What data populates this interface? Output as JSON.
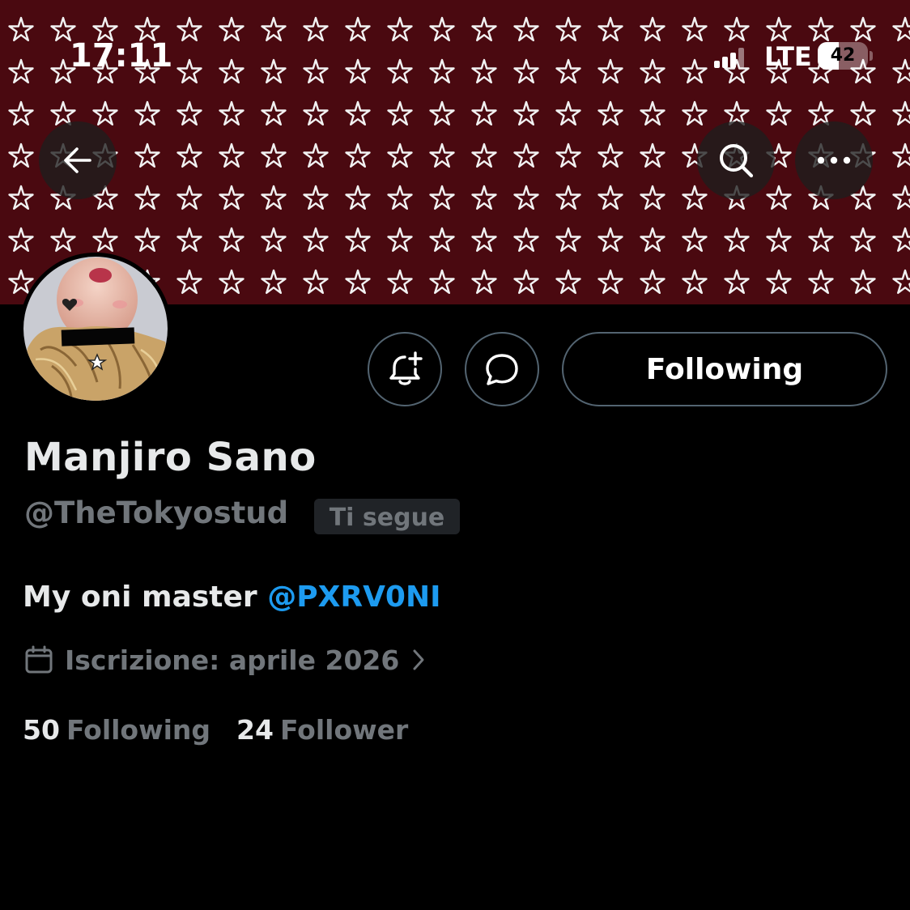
{
  "status_bar": {
    "time": "17:11",
    "network": "LTE",
    "battery_level": "42",
    "battery_fraction": 0.42
  },
  "header": {
    "back_icon": "arrow-left-icon",
    "search_icon": "search-icon",
    "more_icon": "more-horizontal-icon"
  },
  "banner": {
    "pattern": "white stars on dark red",
    "background_color": "#4a0910",
    "star_color": "#f2f2f2"
  },
  "actions": {
    "notifications_icon": "bell-plus-icon",
    "message_icon": "chat-bubble-icon",
    "following_label": "Following"
  },
  "profile": {
    "display_name": "Manjiro Sano",
    "handle": "@TheTokyostud",
    "follows_you_badge": "Ti segue",
    "bio_text": "My oni master ",
    "bio_mention": "@PXRV0NI",
    "joined": "Iscrizione: aprile 2026",
    "following_count": "50",
    "following_label": "Following",
    "followers_count": "24",
    "followers_label": "Follower"
  },
  "colors": {
    "background": "#000000",
    "primary_text": "#e7e9ea",
    "secondary_text": "#71767b",
    "mention": "#1d9bf0",
    "border": "#536471"
  }
}
